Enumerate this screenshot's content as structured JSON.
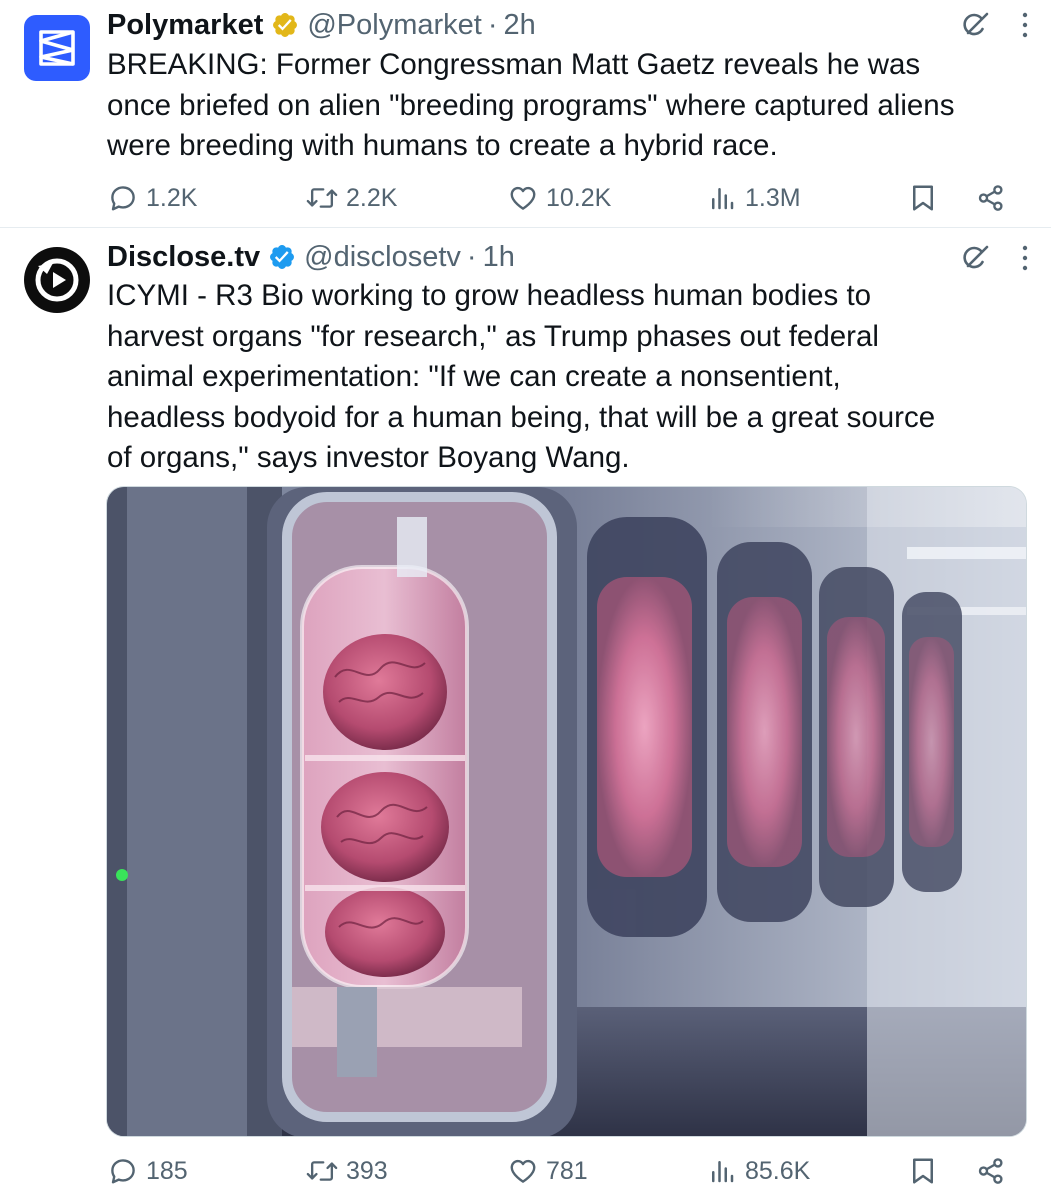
{
  "tweets": [
    {
      "author": {
        "display_name": "Polymarket",
        "handle": "@Polymarket",
        "verified_type": "gold",
        "avatar_icon": "polymarket-logo-icon"
      },
      "separator": "·",
      "time": "2h",
      "text": "BREAKING: Former Congressman Matt Gaetz reveals he was\nonce briefed on alien \"breeding programs\" where captured aliens\nwere breeding with humans to create a hybrid race.",
      "stats": {
        "replies": "1.2K",
        "reposts": "2.2K",
        "likes": "10.2K",
        "views": "1.3M"
      }
    },
    {
      "author": {
        "display_name": "Disclose.tv",
        "handle": "@disclosetv",
        "verified_type": "blue",
        "avatar_icon": "disclosetv-logo-icon"
      },
      "separator": "·",
      "time": "1h",
      "text": "ICYMI - R3 Bio working to grow headless human bodies to\nharvest organs \"for research,\" as Trump phases out federal\nanimal experimentation: \"If we can create a nonsentient,\nheadless bodyoid for a human being, that will be a great source\nof organs,\" says investor Boyang Wang.",
      "media": {
        "kind": "photo",
        "depiction": "rows of lab incubator pods containing pink brain-like organ tissue"
      },
      "stats": {
        "replies": "185",
        "reposts": "393",
        "likes": "781",
        "views": "85.6K"
      }
    }
  ],
  "colors": {
    "text_primary": "#0f1419",
    "text_secondary": "#536471",
    "verified_gold": "#e2b719",
    "verified_blue": "#1d9bf0",
    "polymarket_blue": "#2e5cff",
    "divider": "#e6ecf0"
  },
  "icons": {
    "reply": "reply-icon",
    "repost": "repost-icon",
    "like": "like-icon",
    "views": "views-icon",
    "bookmark": "bookmark-icon",
    "share": "share-icon",
    "grok": "grok-icon",
    "more": "more-icon"
  }
}
